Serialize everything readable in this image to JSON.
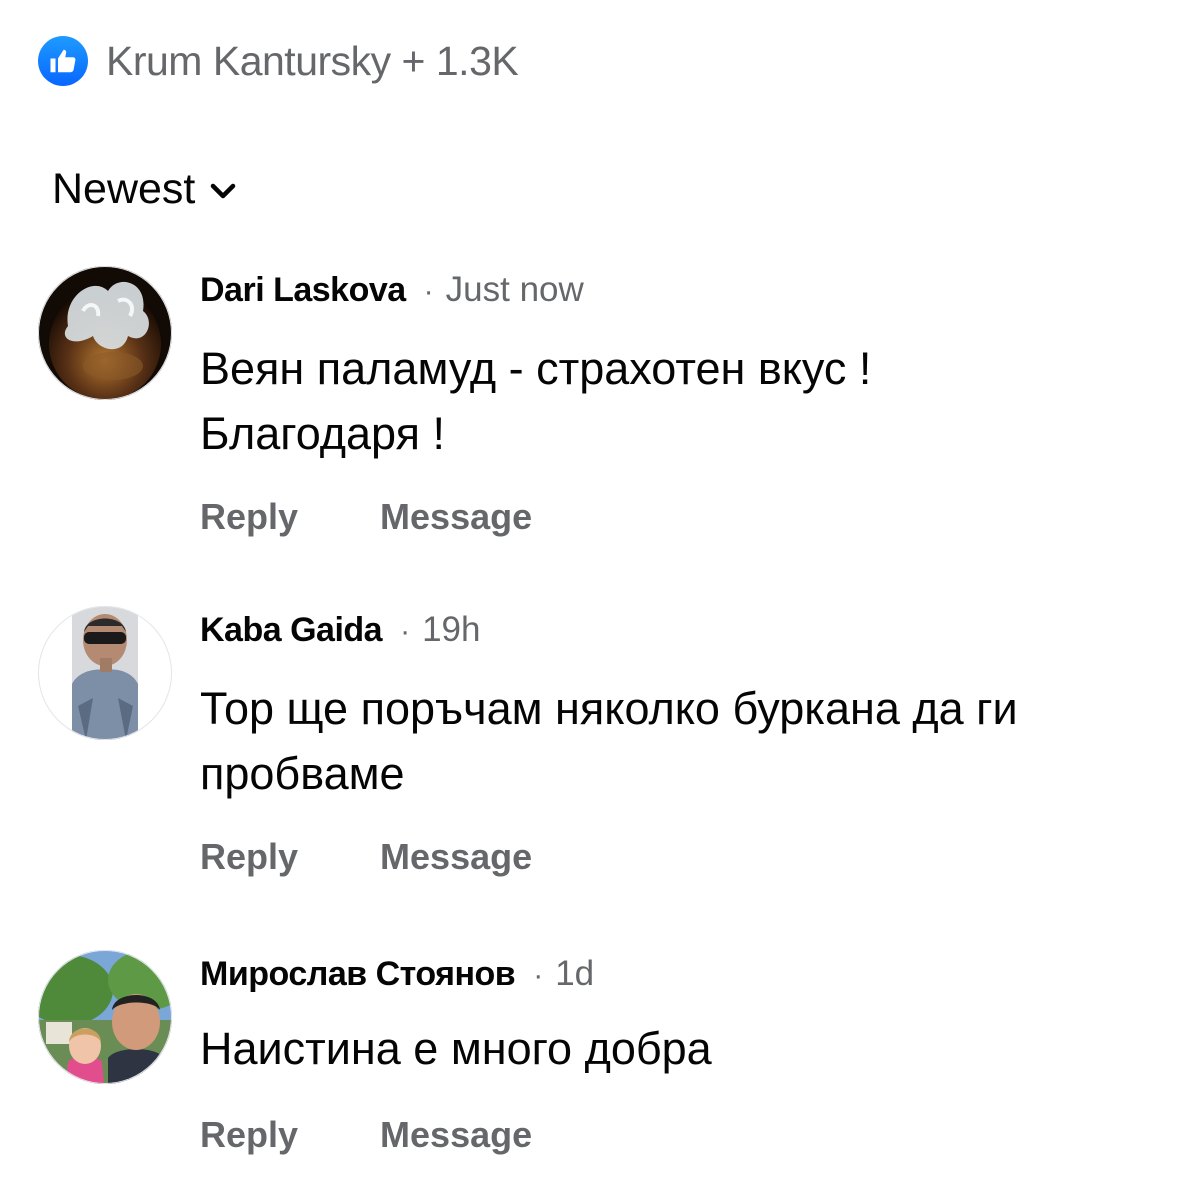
{
  "reactions": {
    "icon": "thumbs-up-icon",
    "accent_color": "#0866ff",
    "text": "Krum Kantursky + 1.3K"
  },
  "sort": {
    "label": "Newest",
    "icon": "chevron-down-icon"
  },
  "comments": [
    {
      "author": "Dari Laskova",
      "separator": "·",
      "time": "Just now",
      "text": "Веян паламуд - страхотен вкус ! Благодаря !",
      "actions": [
        "Reply",
        "Message"
      ]
    },
    {
      "author": "Kaba Gaida",
      "separator": "·",
      "time": "19h",
      "text": "Тор ще поръчам няколко буркана да ги пробваме",
      "actions": [
        "Reply",
        "Message"
      ]
    },
    {
      "author": "Мирослав Стоянов",
      "separator": "·",
      "time": "1d",
      "text": "Наистина е много добра",
      "actions": [
        "Reply",
        "Message"
      ]
    }
  ]
}
